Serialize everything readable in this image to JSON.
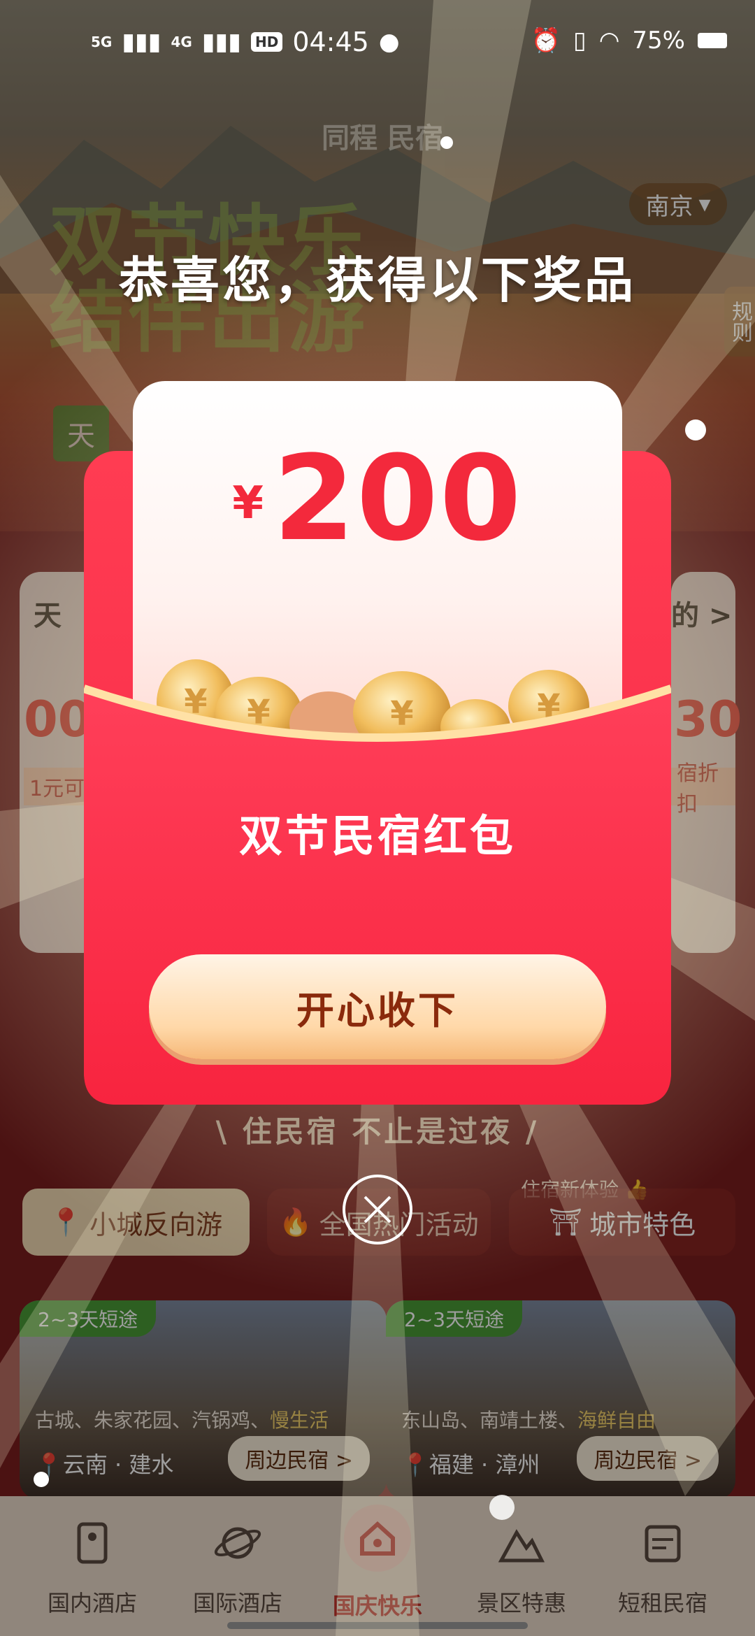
{
  "status_bar": {
    "signal1": "5G",
    "signal2": "4G",
    "hd": "HD",
    "time": "04:45",
    "battery": "75%"
  },
  "background": {
    "logo": "同程 民宿",
    "city": "南京",
    "rules_tab": "规则",
    "hero_title_line1": "双节快乐",
    "hero_title_line2": "结伴出游",
    "green_tag": "天",
    "left_card": {
      "title": "天",
      "number": "00",
      "sub": "1元可"
    },
    "right_card": {
      "title": "的 >",
      "number": "30",
      "sub": "宿折扣"
    },
    "slogan": "\\ 住民宿 不止是过夜 /",
    "chip_tag": "住宿新体验",
    "chips": [
      "小城反向游",
      "全国热门活动",
      "城市特色"
    ],
    "destinations": [
      {
        "badge": "2~3天短途",
        "desc": "古城、朱家花园、汽锅鸡、",
        "highlight": "慢生活",
        "location": "云南 · 建水",
        "button": "周边民宿 >"
      },
      {
        "badge": "2~3天短途",
        "desc": "东山岛、南靖土楼、",
        "highlight": "海鲜自由",
        "location": "福建 · 漳州",
        "button": "周边民宿 >"
      }
    ]
  },
  "tabbar": [
    {
      "label": "国内酒店",
      "icon": "hotel-domestic-icon"
    },
    {
      "label": "国际酒店",
      "icon": "planet-icon"
    },
    {
      "label": "国庆快乐",
      "icon": "home-icon",
      "active": true
    },
    {
      "label": "景区特惠",
      "icon": "scenic-icon"
    },
    {
      "label": "短租民宿",
      "icon": "calendar-icon"
    }
  ],
  "modal": {
    "congrats": "恭喜您，获得以下奖品",
    "currency": "¥",
    "amount": "200",
    "packet_name": "双节民宿红包",
    "accept_button": "开心收下",
    "close_icon": "close-icon"
  },
  "colors": {
    "packet_red": "#f72946",
    "amount_red": "#f3293c",
    "button_text": "#8a2a0c",
    "active_tab": "#c4322a"
  }
}
